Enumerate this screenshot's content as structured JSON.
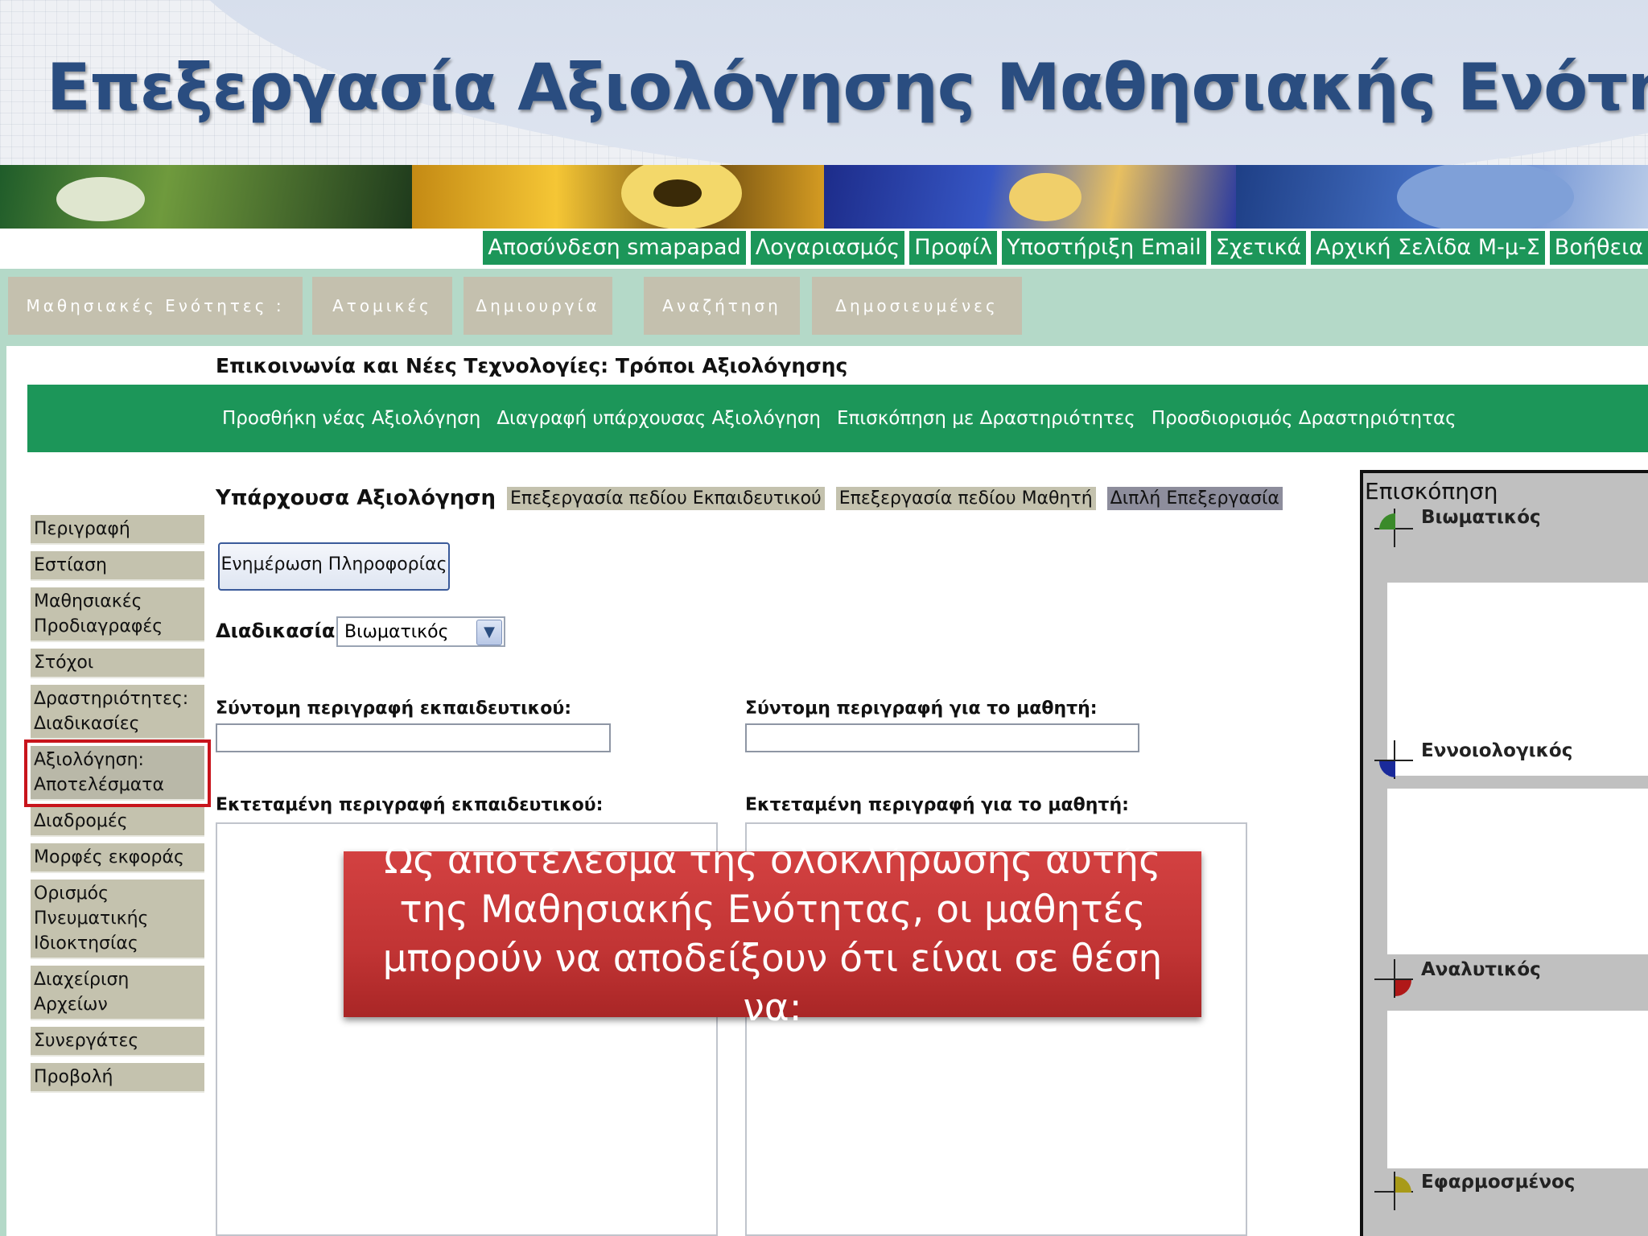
{
  "slide": {
    "title": "Επεξεργασία Αξιολόγησης Μαθησιακής Ενότητας"
  },
  "top_nav": [
    {
      "label": "Αποσύνδεση smapapad"
    },
    {
      "label": "Λογαριασμός"
    },
    {
      "label": "Προφίλ"
    },
    {
      "label": "Υποστήριξη Email"
    },
    {
      "label": "Σχετικά"
    },
    {
      "label": "Αρχική Σελίδα Μ-μ-Σ"
    },
    {
      "label": "Βοήθεια"
    }
  ],
  "tabs": [
    {
      "label": "Μαθησιακές Ενότητες :"
    },
    {
      "label": "Ατομικές"
    },
    {
      "label": "Δημιουργία"
    },
    {
      "label": "Αναζήτηση"
    },
    {
      "label": "Δημοσιευμένες"
    }
  ],
  "course_title": "Επικοινωνία και Νέες Τεχνολογίες: Τρόποι Αξιολόγησης",
  "action_links": [
    {
      "label": "Προσθήκη νέας Αξιολόγηση"
    },
    {
      "label": "Διαγραφή υπάρχουσας Αξιολόγηση"
    },
    {
      "label": "Επισκόπηση με Δραστηριότητες"
    },
    {
      "label": "Προσδιορισμός Δραστηριότητας"
    }
  ],
  "sidebar": {
    "items": [
      {
        "label": "Περιγραφή"
      },
      {
        "label": "Εστίαση"
      },
      {
        "label": "Μαθησιακές Προδιαγραφές"
      },
      {
        "label": "Στόχοι"
      },
      {
        "label": "Δραστηριότητες: Διαδικασίες"
      },
      {
        "label": "Αξιολόγηση: Αποτελέσματα"
      },
      {
        "label": "Διαδρομές"
      },
      {
        "label": "Μορφές εκφοράς"
      },
      {
        "label": "Ορισμός Πνευματικής Ιδιοκτησίας"
      },
      {
        "label": "Διαχείριση Αρχείων"
      },
      {
        "label": "Συνεργάτες"
      },
      {
        "label": "Προβολή"
      }
    ],
    "active_index": 5
  },
  "form": {
    "section_label": "Υπάρχουσα Αξιολόγηση",
    "edit_tabs": [
      {
        "label": "Επεξεργασία πεδίου Εκπαιδευτικού"
      },
      {
        "label": "Επεξεργασία πεδίου Μαθητή"
      },
      {
        "label": "Διπλή Επεξεργασία"
      }
    ],
    "update_button": "Ενημέρωση Πληροφορίας",
    "process_label": "Διαδικασία:",
    "process_value": "Βιωματικός",
    "short_teacher_label": "Σύντομη περιγραφή εκπαιδευτικού:",
    "short_student_label": "Σύντομη περιγραφή για το μαθητή:",
    "long_teacher_label": "Εκτεταμένη περιγραφή εκπαιδευτικού:",
    "long_student_label": "Εκτεταμένη περιγραφή για το μαθητή:"
  },
  "overview": {
    "title": "Επισκόπηση",
    "rows": [
      {
        "label": "Βιωματικός",
        "color": "#3a8a2a"
      },
      {
        "label": "Εννοιολογικός",
        "color": "#1a2a9a"
      },
      {
        "label": "Αναλυτικός",
        "color": "#b01818"
      },
      {
        "label": "Εφαρμοσμένος",
        "color": "#a89a18"
      }
    ]
  },
  "callout": {
    "text": "Ως αποτέλεσμα της ολοκλήρωσης αυτής της Μαθησιακής Ενότητας, οι μαθητές μπορούν να αποδείξουν ότι είναι σε θέση να:"
  },
  "colors": {
    "green": "#1c9659",
    "title_blue": "#2a4d80",
    "callout_red": "#c13434",
    "mint": "#b4d9c8",
    "tab_gray": "#c4c0ae"
  }
}
